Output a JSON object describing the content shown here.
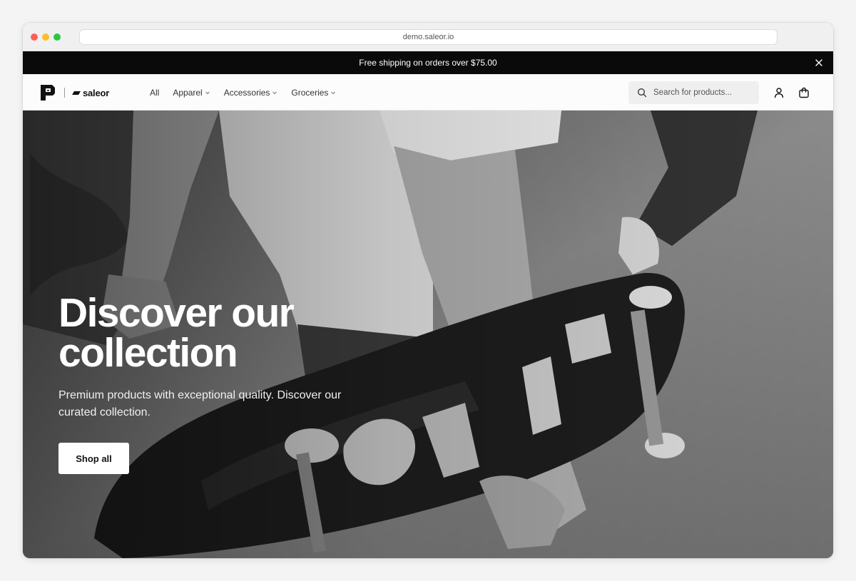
{
  "browser": {
    "url": "demo.saleor.io"
  },
  "promo": {
    "text": "Free shipping on orders over $75.00",
    "close_icon": "close-icon"
  },
  "header": {
    "brand": "saleor",
    "nav": [
      {
        "label": "All",
        "has_dropdown": false
      },
      {
        "label": "Apparel",
        "has_dropdown": true
      },
      {
        "label": "Accessories",
        "has_dropdown": true
      },
      {
        "label": "Groceries",
        "has_dropdown": true
      }
    ],
    "search": {
      "placeholder": "Search for products...",
      "icon": "search-icon"
    },
    "account_icon": "user-icon",
    "cart_icon": "shopping-bag-icon"
  },
  "hero": {
    "title": "Discover our collection",
    "subtitle": "Premium products with exceptional quality. Discover our curated collection.",
    "cta_label": "Shop all"
  },
  "colors": {
    "promo_bg": "#0a0a0a",
    "nav_bg": "#fcfcfc",
    "search_bg": "#efefef",
    "hero_text": "#ffffff"
  }
}
